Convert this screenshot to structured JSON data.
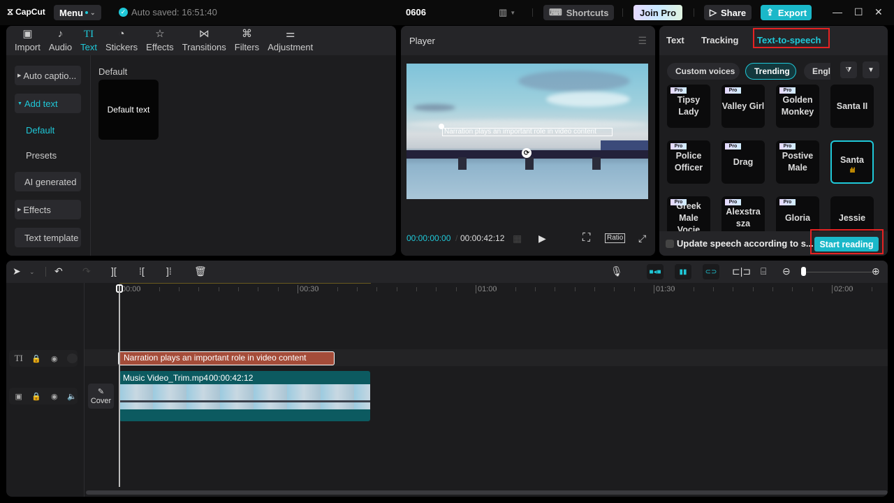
{
  "titlebar": {
    "logo": "CapCut",
    "menu_label": "Menu",
    "autosave": "Auto saved: 16:51:40",
    "project_title": "0606",
    "shortcuts_label": "Shortcuts",
    "joinpro_label": "Join Pro",
    "share_label": "Share",
    "export_label": "Export"
  },
  "left_tabs": [
    {
      "label": "Import",
      "icon": "import-icon"
    },
    {
      "label": "Audio",
      "icon": "audio-icon"
    },
    {
      "label": "Text",
      "icon": "text-icon",
      "active": true
    },
    {
      "label": "Stickers",
      "icon": "stickers-icon"
    },
    {
      "label": "Effects",
      "icon": "effects-icon"
    },
    {
      "label": "Transitions",
      "icon": "transitions-icon"
    },
    {
      "label": "Filters",
      "icon": "filters-icon"
    },
    {
      "label": "Adjustment",
      "icon": "adjustment-icon"
    }
  ],
  "left_sidebar": {
    "auto_captions": "Auto captio...",
    "add_text": "Add text",
    "default": "Default",
    "presets": "Presets",
    "ai_generated": "AI generated",
    "effects": "Effects",
    "text_template": "Text template"
  },
  "content": {
    "section_label": "Default",
    "card_label": "Default text"
  },
  "player": {
    "title": "Player",
    "overlay_text": "Narration plays an important role in video content",
    "current_time": "00:00:00:00",
    "total_time": "00:00:42:12",
    "ratio_label": "Ratio"
  },
  "right_panel": {
    "tabs": [
      "Text",
      "Tracking",
      "Text-to-speech"
    ],
    "active_tab": "Text-to-speech",
    "chips": [
      "Custom voices",
      "Trending",
      "Engl"
    ],
    "active_chip": "Trending",
    "voices": [
      {
        "name": "Tipsy Lady",
        "pro": true
      },
      {
        "name": "Valley Girl",
        "pro": true
      },
      {
        "name": "Golden Monkey",
        "pro": true
      },
      {
        "name": "Santa II",
        "pro": false
      },
      {
        "name": "Police Officer",
        "pro": true
      },
      {
        "name": "Drag",
        "pro": true
      },
      {
        "name": "Postive Male",
        "pro": true
      },
      {
        "name": "Santa",
        "pro": false,
        "selected": true
      },
      {
        "name": "Greek Male Vocie",
        "pro": true
      },
      {
        "name": "Alexstra sza",
        "pro": true
      },
      {
        "name": "Gloria",
        "pro": true
      },
      {
        "name": "Jessie",
        "pro": false
      }
    ],
    "pro_badge": "Pro",
    "update_label": "Update speech according to s...",
    "start_reading_label": "Start reading"
  },
  "timeline": {
    "ruler_labels": [
      "00:00",
      "00:30",
      "01:00",
      "01:30",
      "02:00"
    ],
    "text_clip": "Narration plays an important role in video content",
    "video_clip_name": "Music Video_Trim.mp4",
    "video_clip_duration": "00:00:42:12",
    "cover_label": "Cover",
    "zoom_level": 0.05
  },
  "colors": {
    "accent": "#1fc8d8",
    "highlight": "#e52222",
    "text_clip": "#a44c39",
    "video_clip": "#0c5a60"
  }
}
